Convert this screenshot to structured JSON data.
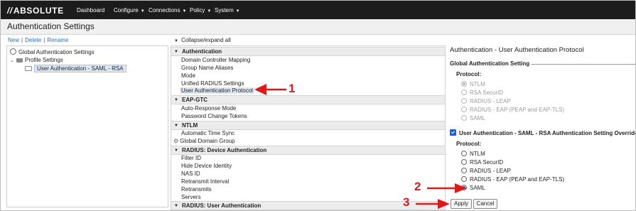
{
  "nav": {
    "logo": "ABSOLUTE",
    "items": [
      {
        "label": "Dashboard",
        "dropdown": false
      },
      {
        "label": "Configure",
        "dropdown": true
      },
      {
        "label": "Connections",
        "dropdown": true
      },
      {
        "label": "Policy",
        "dropdown": true
      },
      {
        "label": "System",
        "dropdown": true
      }
    ]
  },
  "page": {
    "title": "Authentication Settings"
  },
  "toolbar": {
    "new": "New",
    "delete": "Delete",
    "rename": "Rename"
  },
  "collapse": {
    "label": "Collapse/expand all"
  },
  "tree": {
    "root": "Global Authentication Settings",
    "folder": "Profile Settings",
    "selected": "User Authentication - SAML - RSA"
  },
  "attributes": {
    "groups": [
      {
        "header": "Authentication",
        "items": [
          "Domain Controller Mapping",
          "Group Name Aliases",
          "Mode",
          "Unified RADIUS Settings",
          "User Authentication Protocol"
        ]
      },
      {
        "header": "EAP-GTC",
        "items": [
          "Auto-Response Mode",
          "Password Change Tokens"
        ]
      },
      {
        "header": "NTLM",
        "items": [
          "Automatic Time Sync",
          "Global Domain Group"
        ]
      },
      {
        "header": "RADIUS: Device Authentication",
        "items": [
          "Filter ID",
          "Hide Device Identity",
          "NAS ID",
          "Retransmit Interval",
          "Retransmits",
          "Servers"
        ]
      },
      {
        "header": "RADIUS: User Authentication",
        "items": []
      }
    ]
  },
  "settings": {
    "title": "Authentication - User Authentication Protocol",
    "global": {
      "label": "Global Authentication Setting",
      "protocol_label": "Protocol:",
      "options": [
        "NTLM",
        "RSA SecurID",
        "RADIUS - LEAP",
        "RADIUS - EAP (PEAP and EAP-TLS)",
        "SAML"
      ],
      "selected": "NTLM"
    },
    "override": {
      "label": "User Authentication - SAML - RSA Authentication Setting Override",
      "checked": true,
      "protocol_label": "Protocol:",
      "options": [
        "NTLM",
        "RSA SecurID",
        "RADIUS - LEAP",
        "RADIUS - EAP (PEAP and EAP-TLS)",
        "SAML"
      ],
      "selected": "SAML"
    },
    "apply": "Apply",
    "cancel": "Cancel"
  },
  "annotations": {
    "one": "1",
    "two": "2",
    "three": "3"
  },
  "colors": {
    "accent": "#1a5fcf",
    "annotation": "#e0181c",
    "nav_bg": "#1c1c1c"
  }
}
